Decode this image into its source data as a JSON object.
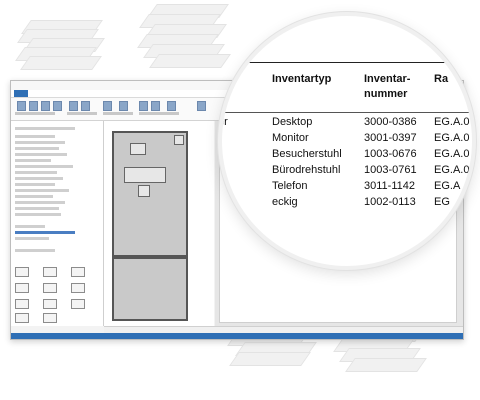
{
  "table": {
    "headers": {
      "type": "Inventartyp",
      "number_line1": "Inventar-",
      "number_line2": "nummer",
      "room_partial": "Ra"
    },
    "left_fragment": "er",
    "rows": [
      {
        "type": "Desktop",
        "number": "3000-0386",
        "room": "EG.A.0"
      },
      {
        "type": "Monitor",
        "number": "3001-0397",
        "room": "EG.A.0"
      },
      {
        "type": "Besucherstuhl",
        "number": "1003-0676",
        "room": "EG.A.0"
      },
      {
        "type": "Bürodrehstuhl",
        "number": "1003-0761",
        "room": "EG.A.0"
      },
      {
        "type": "Telefon",
        "number": "3011-1142",
        "room": "EG.A"
      },
      {
        "type": "eckig",
        "number": "1002-0113",
        "room": "EG"
      }
    ]
  },
  "colors": {
    "accent": "#2f6fb5"
  },
  "icons": [
    "paper-stack-icon"
  ]
}
